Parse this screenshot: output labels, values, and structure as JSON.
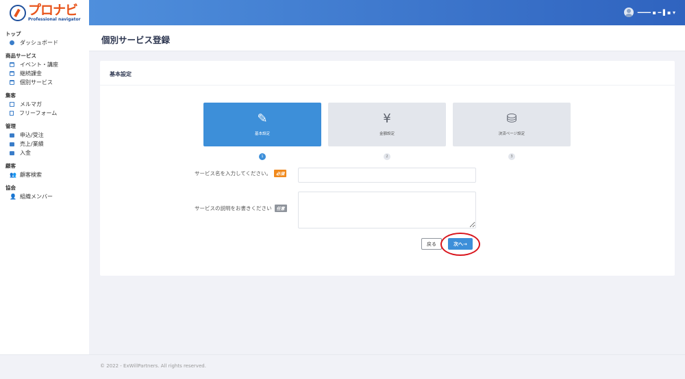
{
  "brand": {
    "name": "プロナビ",
    "tagline": "Professional navigator"
  },
  "header": {
    "user_name": "━━━━ ▪ ━ ▌▪ ▾"
  },
  "page_title": "個別サービス登録",
  "sidebar": {
    "sections": [
      {
        "heading": "トップ",
        "items": [
          {
            "label": "ダッシュボード",
            "icon": "dashboard-icon"
          }
        ]
      },
      {
        "heading": "商品サービス",
        "items": [
          {
            "label": "イベント・講座",
            "icon": "calendar-icon"
          },
          {
            "label": "継続課金",
            "icon": "calendar-icon"
          },
          {
            "label": "個別サービス",
            "icon": "calendar-icon"
          }
        ]
      },
      {
        "heading": "集客",
        "items": [
          {
            "label": "メルマガ",
            "icon": "mail-icon"
          },
          {
            "label": "フリーフォーム",
            "icon": "document-icon"
          }
        ]
      },
      {
        "heading": "管理",
        "items": [
          {
            "label": "申込/受注",
            "icon": "briefcase-icon"
          },
          {
            "label": "売上/業績",
            "icon": "briefcase-icon"
          },
          {
            "label": "入金",
            "icon": "briefcase-icon"
          }
        ]
      },
      {
        "heading": "顧客",
        "items": [
          {
            "label": "顧客検索",
            "icon": "users-icon"
          }
        ]
      },
      {
        "heading": "協会",
        "items": [
          {
            "label": "組織メンバー",
            "icon": "user-icon"
          }
        ]
      }
    ]
  },
  "card": {
    "heading": "基本設定",
    "steps": [
      {
        "label": "基本設定",
        "icon": "✎",
        "number": "1",
        "active": true
      },
      {
        "label": "金額設定",
        "icon": "¥",
        "number": "2",
        "active": false
      },
      {
        "label": "決済ページ設定",
        "icon": "⛁",
        "number": "3",
        "active": false
      }
    ],
    "fields": {
      "name_label": "サービス名を入力してください。",
      "name_badge": "必須",
      "name_value": "",
      "desc_label": "サービスの説明をお書きください",
      "desc_badge": "任意",
      "desc_value": ""
    },
    "buttons": {
      "back": "戻る",
      "next": "次へ→"
    }
  },
  "footer": {
    "copyright": "© 2022 - ExWillPartners. All rights reserved."
  },
  "colors": {
    "accent": "#3d8fd9",
    "brand": "#e8541b",
    "highlight": "#d9141c"
  }
}
